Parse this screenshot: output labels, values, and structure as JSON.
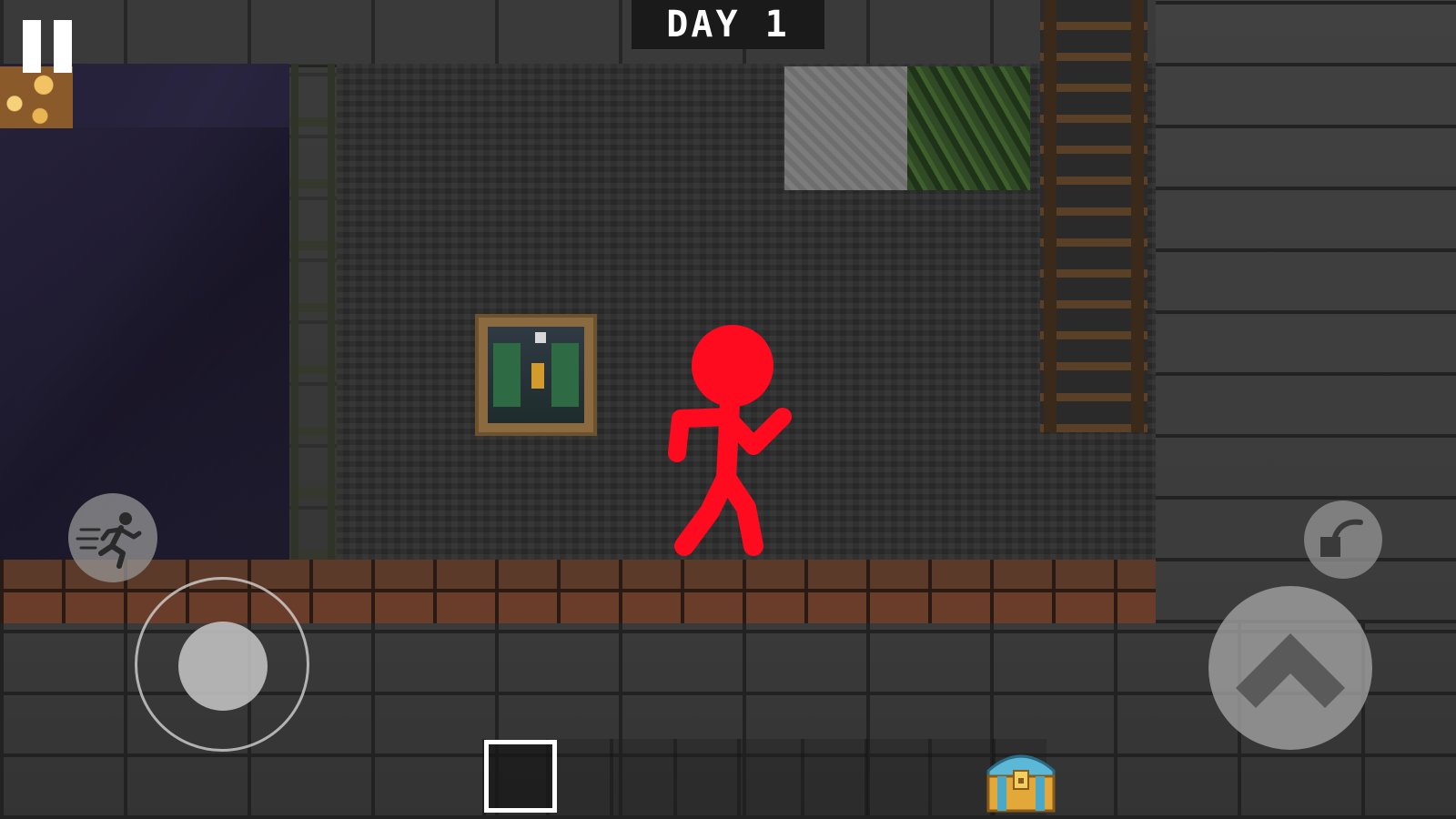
{
  "hud": {
    "day_label": "DAY 1"
  },
  "controls": {
    "pause_icon": "pause-icon",
    "sprint_icon": "running-person-icon",
    "joystick_icon": "joystick-icon",
    "place_icon": "place-block-icon",
    "jump_icon": "chevron-up-icon",
    "inventory_icon": "treasure-chest-icon"
  },
  "hotbar": {
    "selected_slot_index": 0
  },
  "colors": {
    "player": "#ff0b1f",
    "day_banner_bg": "#1a1a1a",
    "day_banner_text": "#ffffff"
  }
}
